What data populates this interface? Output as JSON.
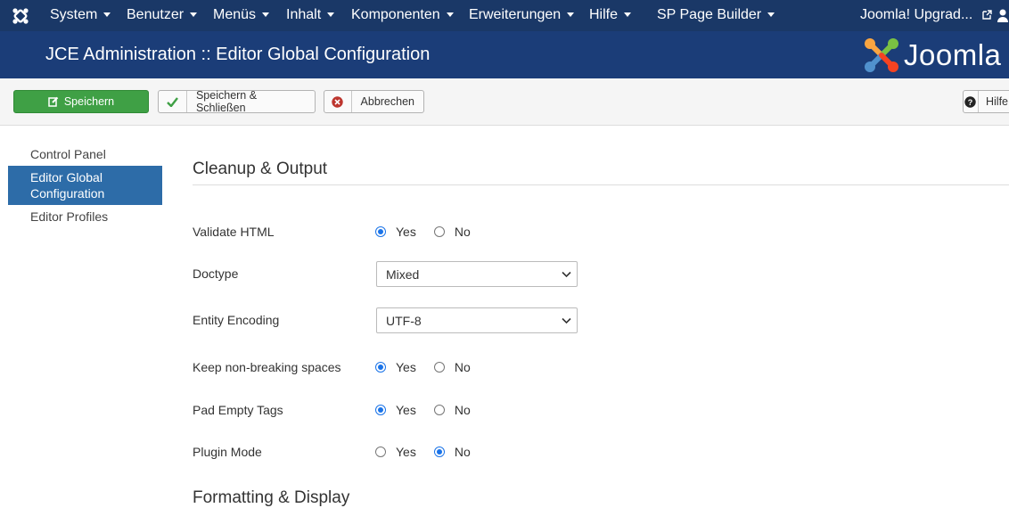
{
  "navbar": {
    "items": [
      {
        "label": "System",
        "caret": true
      },
      {
        "label": "Benutzer",
        "caret": true
      },
      {
        "label": "Menüs",
        "caret": true
      },
      {
        "label": "Inhalt",
        "caret": true
      },
      {
        "label": "Komponenten",
        "caret": true
      },
      {
        "label": "Erweiterungen",
        "caret": true
      },
      {
        "label": "Hilfe",
        "caret": true
      },
      {
        "label": "SP Page Builder",
        "caret": true
      }
    ],
    "site_link": "Joomla! Upgrad..."
  },
  "header": {
    "title": "JCE Administration :: Editor Global Configuration",
    "logo_text": "Joomla"
  },
  "toolbar": {
    "save": "Speichern",
    "save_close": "Speichern & Schließen",
    "cancel": "Abbrechen",
    "help": "Hilfe"
  },
  "sidebar": {
    "items": [
      "Control Panel",
      "Editor Global Configuration",
      "Editor Profiles"
    ],
    "active": 1
  },
  "main": {
    "section1": "Cleanup & Output",
    "section2": "Formatting & Display",
    "rows": [
      {
        "label": "Validate HTML",
        "type": "radio",
        "options": [
          "Yes",
          "No"
        ],
        "selected": "Yes"
      },
      {
        "label": "Doctype",
        "type": "select",
        "value": "Mixed"
      },
      {
        "label": "Entity Encoding",
        "type": "select",
        "value": "UTF-8"
      },
      {
        "label": "Keep non-breaking spaces",
        "type": "radio",
        "options": [
          "Yes",
          "No"
        ],
        "selected": "Yes"
      },
      {
        "label": "Pad Empty Tags",
        "type": "radio",
        "options": [
          "Yes",
          "No"
        ],
        "selected": "Yes"
      },
      {
        "label": "Plugin Mode",
        "type": "radio",
        "options": [
          "Yes",
          "No"
        ],
        "selected": "No"
      }
    ]
  },
  "colors": {
    "navbar": "#1a3867",
    "header": "#1b3d78",
    "save_button": "#3fa045",
    "sidebar_active": "#2d6ca8",
    "radio_checked": "#1a73e8"
  }
}
